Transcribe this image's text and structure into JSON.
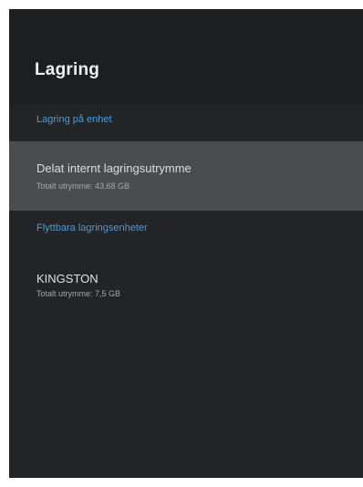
{
  "screen": {
    "title": "Lagring"
  },
  "sections": {
    "internal_header": "Lagring på enhet",
    "removable_header": "Flyttbara lagringsenheter"
  },
  "internal_storage": {
    "title": "Delat internt lagringsutrymme",
    "subtitle": "Totalt utrymme: 43,68 GB"
  },
  "removable_storage": {
    "title": "KINGSTON",
    "subtitle": "Totalt utrymme: 7,5 GB"
  },
  "colors": {
    "background": "#232427",
    "header_background": "#1d1e21",
    "selected_row": "#4b4c4f",
    "accent": "#4b9bd6",
    "text_primary": "#dddddd",
    "text_secondary": "#a7a7a9"
  }
}
